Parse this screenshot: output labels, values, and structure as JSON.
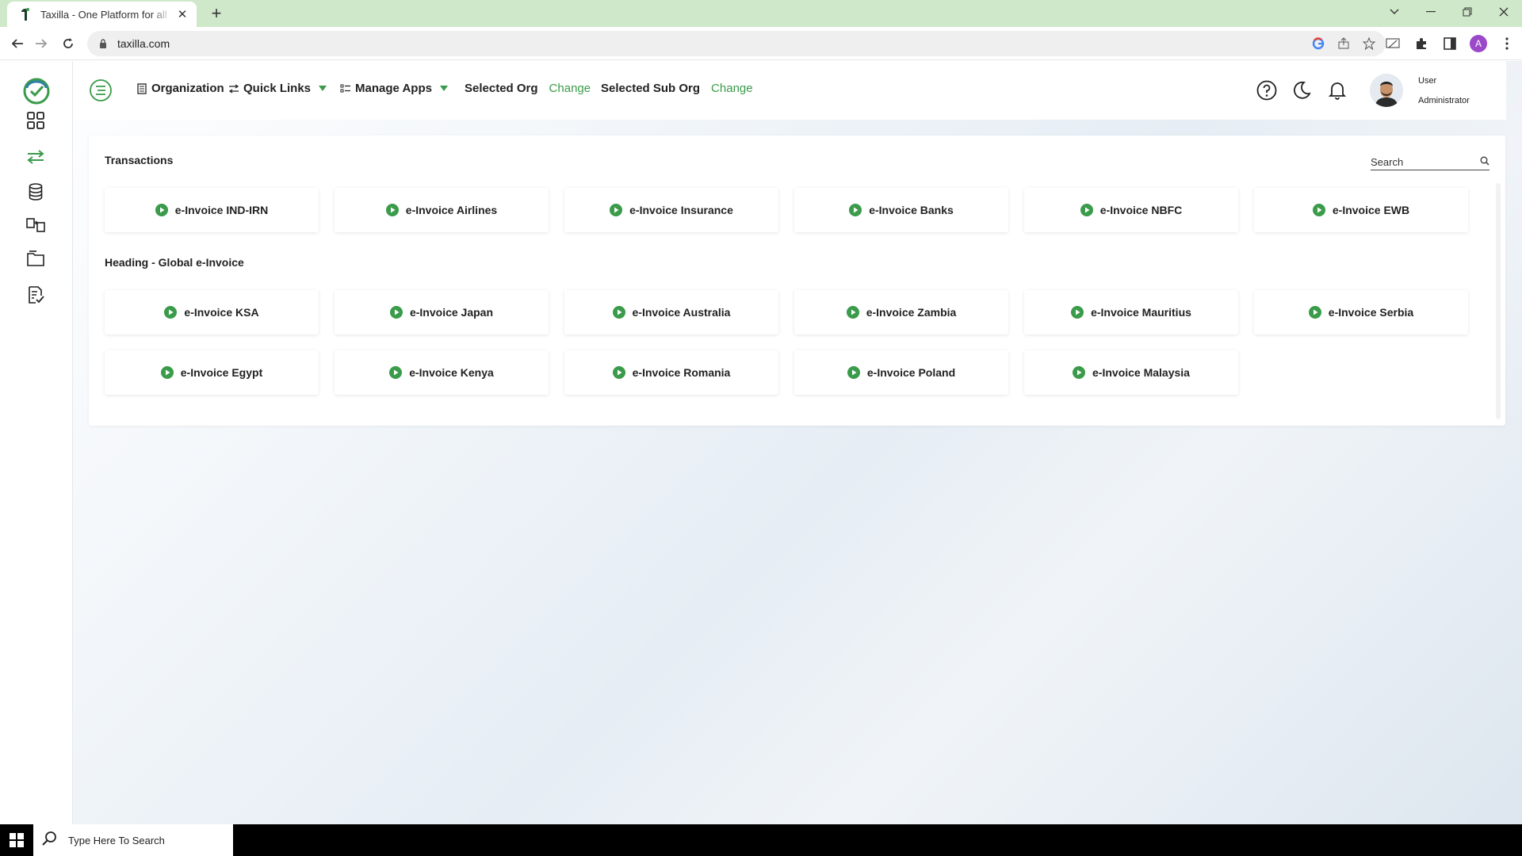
{
  "browser": {
    "tab_title": "Taxilla - One Platform for all Enterprise",
    "url": "taxilla.com",
    "profile_initial": "A"
  },
  "header": {
    "organization": "Organization",
    "quick_links": "Quick Links",
    "manage_apps": "Manage Apps",
    "selected_org": "Selected Org",
    "selected_org_change": "Change",
    "selected_sub_org": "Selected Sub Org",
    "selected_sub_org_change": "Change",
    "user_name": "User",
    "user_role": "Administrator"
  },
  "search": {
    "label": "Search"
  },
  "sections": [
    {
      "heading": "Transactions",
      "apps": [
        "e-Invoice IND-IRN",
        "e-Invoice Airlines",
        "e-Invoice Insurance",
        "e-Invoice Banks",
        "e-Invoice NBFC",
        "e-Invoice EWB"
      ]
    },
    {
      "heading": "Heading - Global e-Invoice",
      "apps": [
        "e-Invoice KSA",
        "e-Invoice Japan",
        "e-Invoice Australia",
        "e-Invoice Zambia",
        "e-Invoice Mauritius",
        "e-Invoice Serbia",
        "e-Invoice Egypt",
        "e-Invoice Kenya",
        "e-Invoice Romania",
        "e-Invoice Poland",
        "e-Invoice Malaysia"
      ]
    }
  ],
  "taskbar": {
    "search_placeholder": "Type Here To Search"
  },
  "colors": {
    "accent": "#3a9b4a",
    "tabbar": "#cfe8c9"
  }
}
